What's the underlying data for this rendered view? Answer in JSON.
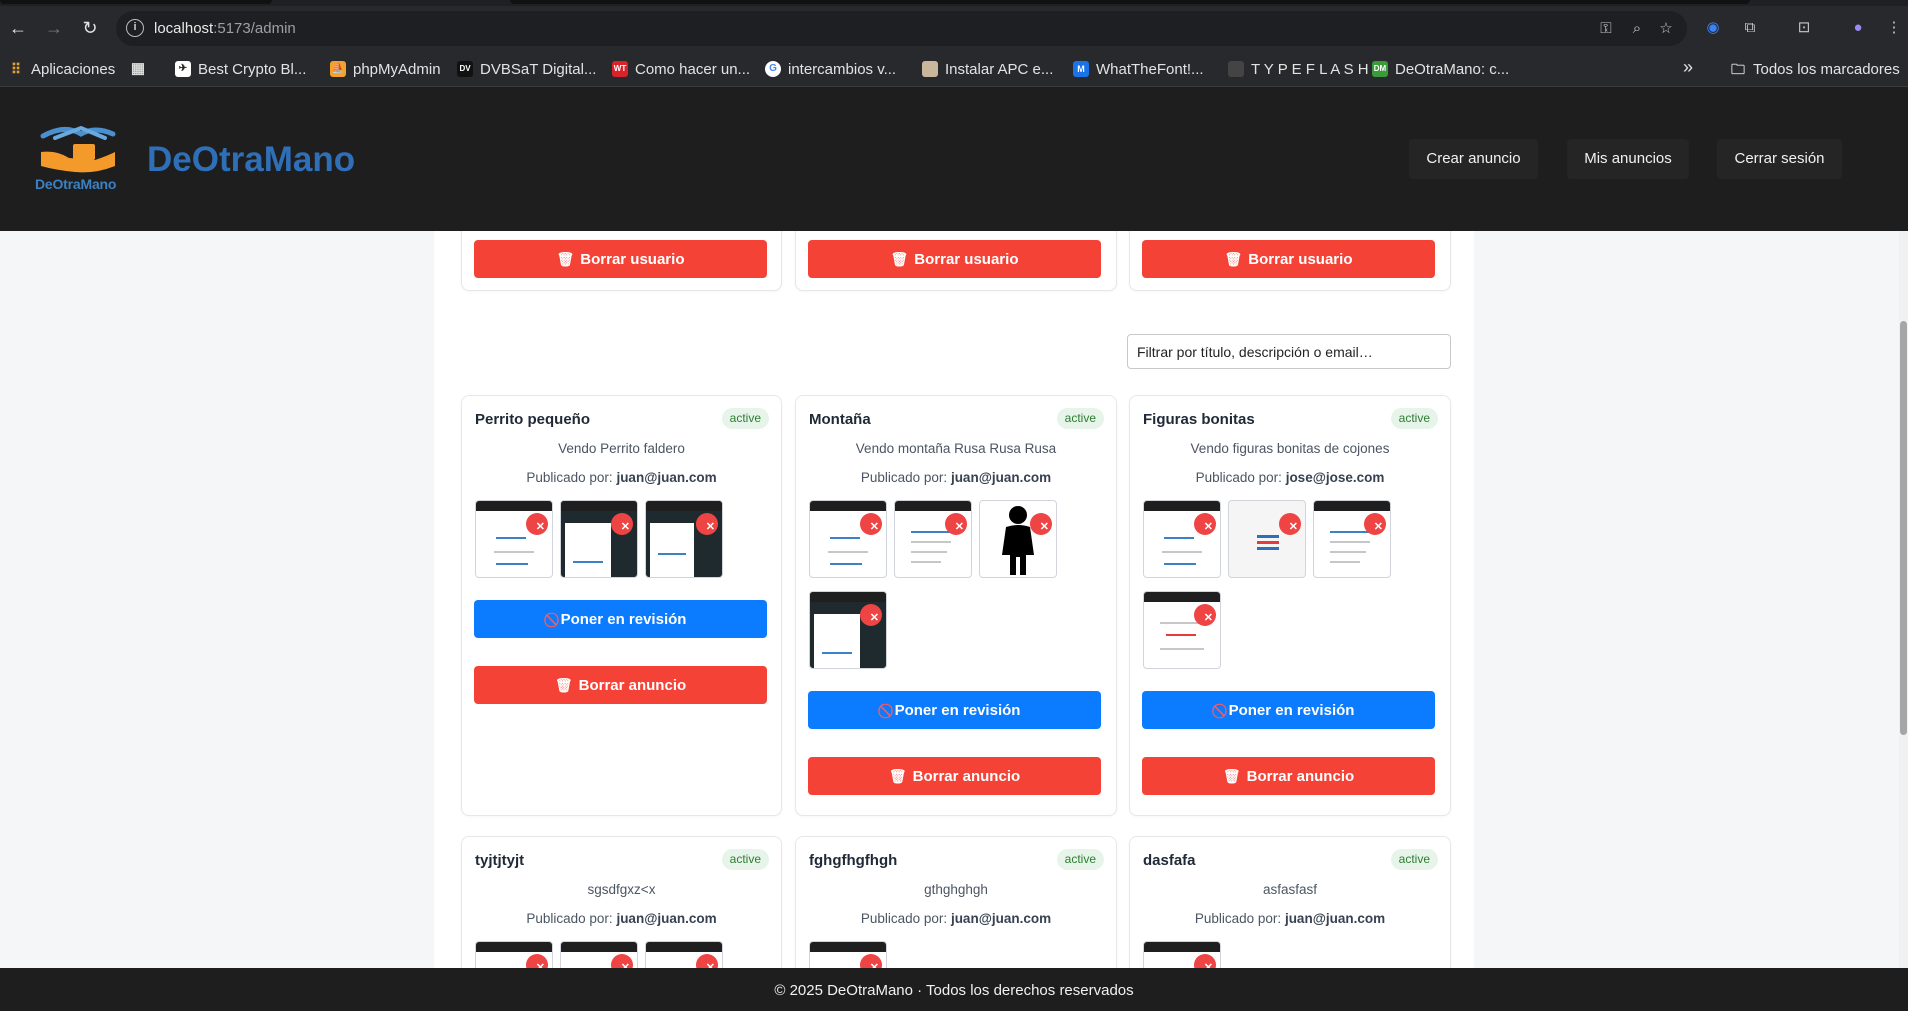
{
  "browser": {
    "url_host": "localhost",
    "url_port": ":5173/admin",
    "bookmarks": [
      {
        "label": "Aplicaciones",
        "icon": "apps-grid-icon"
      },
      {
        "label": "",
        "icon": "grid-icon"
      },
      {
        "label": "Best Crypto Bl...",
        "icon": "rocket-icon"
      },
      {
        "label": "phpMyAdmin",
        "icon": "phpmyadmin-icon"
      },
      {
        "label": "DVBSaT Digital...",
        "icon": "dvb-icon"
      },
      {
        "label": "Como hacer un...",
        "icon": "wt-icon"
      },
      {
        "label": "intercambios v...",
        "icon": "google-icon"
      },
      {
        "label": "Instalar APC e...",
        "icon": "page-icon"
      },
      {
        "label": "WhatTheFont!...",
        "icon": "wtf-icon"
      },
      {
        "label": "T Y P E F L A S H",
        "icon": "typeflash-icon"
      },
      {
        "label": "DeOtraMano: c...",
        "icon": "dm-icon"
      }
    ],
    "bookmarks_overflow": "»",
    "bookmarks_folder": "Todos los marcadores"
  },
  "header": {
    "brand": "DeOtraMano",
    "logo_caption": "DeOtraMano",
    "nav": {
      "create": "Crear anuncio",
      "mine": "Mis anuncios",
      "logout": "Cerrar sesión"
    }
  },
  "users": {
    "delete_label": "Borrar usuario"
  },
  "filter": {
    "placeholder": "Filtrar por título, descripción o email…"
  },
  "ads": {
    "review_label": "Poner en revisión",
    "delete_label": "Borrar anuncio",
    "published_by_label": "Publicado por:",
    "items": [
      {
        "title": "Perrito pequeño",
        "status": "active",
        "description": "Vendo Perrito faldero",
        "email": "juan@juan.com",
        "images": 3
      },
      {
        "title": "Montaña",
        "status": "active",
        "description": "Vendo montaña Rusa Rusa Rusa",
        "email": "juan@juan.com",
        "images": 4
      },
      {
        "title": "Figuras bonitas",
        "status": "active",
        "description": "Vendo figuras bonitas de cojones",
        "email": "jose@jose.com",
        "images": 4
      },
      {
        "title": "tyjtjtyjt",
        "status": "active",
        "description": "sgsdfgxz<x",
        "email": "juan@juan.com",
        "images": 3
      },
      {
        "title": "fghgfhgfhgh",
        "status": "active",
        "description": "gthghghgh",
        "email": "juan@juan.com",
        "images": 1
      },
      {
        "title": "dasfafa",
        "status": "active",
        "description": "asfasfasf",
        "email": "juan@juan.com",
        "images": 1
      }
    ]
  },
  "footer": {
    "text": "© 2025 DeOtraMano · Todos los derechos reservados"
  },
  "colors": {
    "danger": "#f44336",
    "primary": "#0b7bff",
    "brand": "#2f6fb7",
    "header_bg": "#1e1e1e"
  }
}
